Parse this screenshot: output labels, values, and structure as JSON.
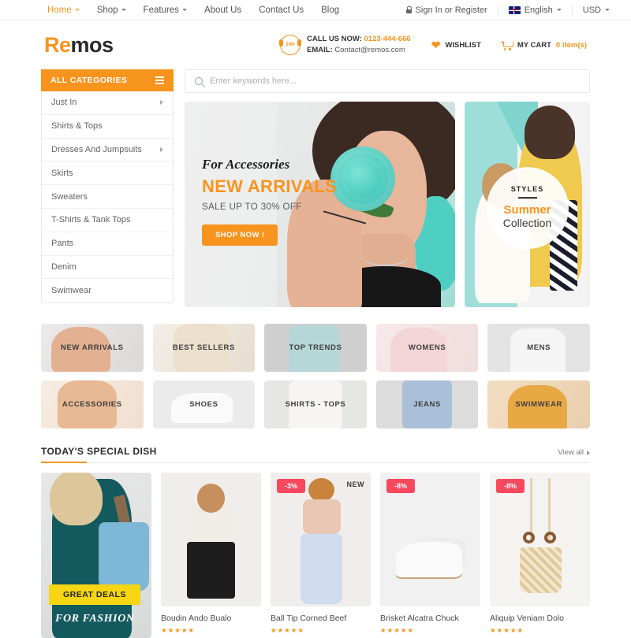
{
  "topbar": {
    "nav": [
      {
        "label": "Home",
        "has_caret": true,
        "active": true
      },
      {
        "label": "Shop",
        "has_caret": true,
        "active": false
      },
      {
        "label": "Features",
        "has_caret": true,
        "active": false
      },
      {
        "label": "About Us",
        "has_caret": false,
        "active": false
      },
      {
        "label": "Contact Us",
        "has_caret": false,
        "active": false
      },
      {
        "label": "Blog",
        "has_caret": false,
        "active": false
      }
    ],
    "account": "Sign In or Register",
    "language": "English",
    "currency": "USD"
  },
  "header": {
    "logo_first": "Re",
    "logo_rest": "mos",
    "call_label": "CALL US NOW:",
    "call_number": "0123-444-666",
    "email_label": "EMAIL:",
    "email_value": "Contact@remos.com",
    "headset_badge": "24H",
    "wishlist": "WISHLIST",
    "cart_label": "MY CART",
    "cart_count": "0 item(s)"
  },
  "sidebar": {
    "title": "ALL CATEGORIES",
    "items": [
      {
        "label": "Just In",
        "has_arrow": true
      },
      {
        "label": "Shirts & Tops",
        "has_arrow": false
      },
      {
        "label": "Dresses And Jumpsuits",
        "has_arrow": true
      },
      {
        "label": "Skirts",
        "has_arrow": false
      },
      {
        "label": "Sweaters",
        "has_arrow": false
      },
      {
        "label": "T-Shirts & Tank Tops",
        "has_arrow": false
      },
      {
        "label": "Pants",
        "has_arrow": false
      },
      {
        "label": "Denim",
        "has_arrow": false
      },
      {
        "label": "Swimwear",
        "has_arrow": false
      }
    ]
  },
  "search": {
    "placeholder": "Enter keywords here...",
    "value": ""
  },
  "hero": {
    "eyebrow": "For Accessories",
    "title": "NEW ARRIVALS",
    "subtitle": "SALE UP TO 30% OFF",
    "button": "SHOP NOW !"
  },
  "promo": {
    "styles": "STYLES",
    "summer": "Summer",
    "collection": "Collection"
  },
  "tiles": {
    "row1": [
      {
        "label": "NEW ARRIVALS",
        "art": "t1"
      },
      {
        "label": "BEST SELLERS",
        "art": "t2"
      },
      {
        "label": "TOP TRENDS",
        "art": "t3"
      },
      {
        "label": "WOMENS",
        "art": "t4"
      },
      {
        "label": "MENS",
        "art": "t5"
      }
    ],
    "row2": [
      {
        "label": "ACCESSORIES",
        "art": "t6"
      },
      {
        "label": "SHOES",
        "art": "t7"
      },
      {
        "label": "SHIRTS - TOPS",
        "art": "t8"
      },
      {
        "label": "JEANS",
        "art": "t9"
      },
      {
        "label": "SWIMWEAR",
        "art": "t10"
      }
    ]
  },
  "section": {
    "title": "TODAY'S SPECIAL DISH",
    "view_all": "View all"
  },
  "deal_card": {
    "banner": "GREAT DEALS",
    "subtitle": "FOR FASHION"
  },
  "products": [
    {
      "name": "Boudin Ando Bualo",
      "badge": "",
      "tag": "",
      "stars": "★★★★★",
      "art": "pi-a"
    },
    {
      "name": "Ball Tip Corned Beef",
      "badge": "-3%",
      "tag": "NEW",
      "stars": "★★★★★",
      "art": "pi-b"
    },
    {
      "name": "Brisket Alcatra Chuck",
      "badge": "-8%",
      "tag": "",
      "stars": "★★★★★",
      "art": "pi-c"
    },
    {
      "name": "Aliquip Veniam Dolo",
      "badge": "-8%",
      "tag": "",
      "stars": "★★★★★",
      "art": "pi-d"
    }
  ],
  "colors": {
    "accent": "#f7941e",
    "badge": "#f8485e",
    "deal_banner": "#f5d514",
    "text": "#444444"
  }
}
